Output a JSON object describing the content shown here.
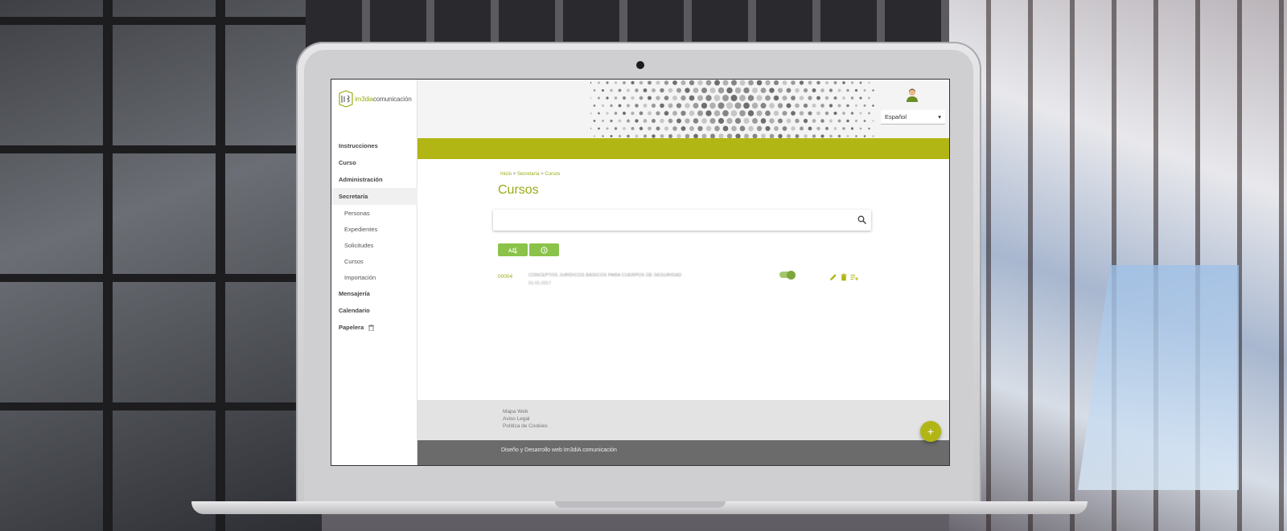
{
  "brand": {
    "logo_text_accent": "im3dia",
    "logo_text": "comunicación"
  },
  "sidebar": {
    "items": [
      {
        "label": "Instrucciones"
      },
      {
        "label": "Curso"
      },
      {
        "label": "Administración"
      },
      {
        "label": "Secretaría",
        "active": true
      },
      {
        "label": "Personas",
        "sub": true
      },
      {
        "label": "Expedientes",
        "sub": true
      },
      {
        "label": "Solicitudes",
        "sub": true
      },
      {
        "label": "Cursos",
        "sub": true
      },
      {
        "label": "Importación",
        "sub": true
      },
      {
        "label": "Mensajería"
      },
      {
        "label": "Calendario"
      },
      {
        "label": "Papelera",
        "icon": "trash-icon"
      }
    ]
  },
  "header": {
    "language": "Español",
    "user_icon": "user-avatar-icon"
  },
  "main": {
    "breadcrumb": {
      "home": "Inicio",
      "section": "Secretaría",
      "current": "Cursos",
      "separator": ">"
    },
    "title": "Cursos",
    "search": {
      "placeholder": "",
      "icon": "search-icon"
    },
    "buttons": [
      {
        "icon": "sort-alpha-icon"
      },
      {
        "icon": "clock-icon"
      }
    ],
    "courses": [
      {
        "id": "00004",
        "title": "CONCEPTOS JURÍDICOS BÁSICOS PARA CUERPOS DE SEGURIDAD",
        "date": "01-01-2017",
        "enabled": true
      }
    ]
  },
  "footer": {
    "links": [
      "Mapa Web",
      "Aviso Legal",
      "Política de Cookies"
    ],
    "credit": "Diseño y Desarrollo web Im3diA comunicación",
    "fab": "+"
  },
  "colors": {
    "accent": "#b2b614",
    "accent_text": "#9aaa14",
    "button": "#8bc34a",
    "footer_bar": "#6b6b6b"
  }
}
